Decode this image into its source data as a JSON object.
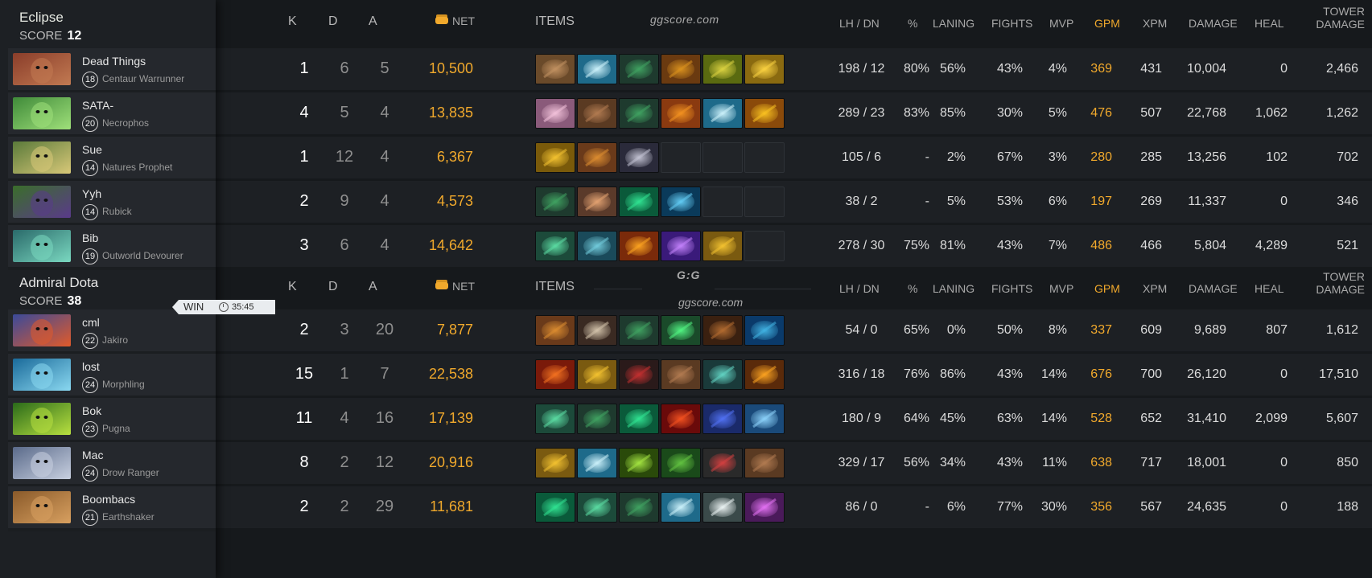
{
  "watermark_text": "ggscore.com",
  "logo": {
    "main": "G:G",
    "sub": "ggscore.com"
  },
  "headers": {
    "k": "K",
    "d": "D",
    "a": "A",
    "net": "NET",
    "items": "ITEMS",
    "lhdn": "LH  /  DN",
    "pct": "%",
    "laning": "LANING",
    "fights": "FIGHTS",
    "mvp": "MVP",
    "gpm": "GPM",
    "xpm": "XPM",
    "damage": "DAMAGE",
    "heal": "HEAL",
    "tower1": "TOWER",
    "tower2": "DAMAGE"
  },
  "result": {
    "label": "WIN",
    "duration": "35:45"
  },
  "teams": [
    {
      "name": "Eclipse",
      "score_label": "SCORE",
      "score": "12",
      "players": [
        {
          "name": "Dead Things",
          "level": "18",
          "hero": "Centaur Warrunner",
          "portrait_colors": [
            "#8a3d2a",
            "#c27a52"
          ],
          "k": "1",
          "d": "6",
          "a": "5",
          "net": "10,500",
          "lhdn": "198  /  12",
          "pct": "80%",
          "laning": "56%",
          "fights": "43%",
          "mvp": "4%",
          "gpm": "369",
          "xpm": "431",
          "damage": "10,004",
          "heal": "0",
          "tower": "2,466",
          "items": [
            "boots",
            "blade",
            "staff",
            "orb",
            "helm",
            "gem"
          ]
        },
        {
          "name": "SATA-",
          "level": "20",
          "hero": "Necrophos",
          "portrait_colors": [
            "#3f8a39",
            "#9fe07a"
          ],
          "k": "4",
          "d": "5",
          "a": "4",
          "net": "13,835",
          "lhdn": "289  /  23",
          "pct": "83%",
          "laning": "85%",
          "fights": "30%",
          "mvp": "5%",
          "gpm": "476",
          "xpm": "507",
          "damage": "22,768",
          "heal": "1,062",
          "tower": "1,262",
          "items": [
            "flower",
            "boots2",
            "staff",
            "fire",
            "blade",
            "dagger"
          ]
        },
        {
          "name": "Sue",
          "level": "14",
          "hero": "Natures Prophet",
          "portrait_colors": [
            "#5a7a3a",
            "#d8c878"
          ],
          "k": "1",
          "d": "12",
          "a": "4",
          "net": "6,367",
          "lhdn": "105  /  6",
          "pct": "-",
          "laning": "2%",
          "fights": "67%",
          "mvp": "3%",
          "gpm": "280",
          "xpm": "285",
          "damage": "13,256",
          "heal": "102",
          "tower": "702",
          "items": [
            "gold",
            "lantern",
            "dark",
            "empty",
            "empty",
            "empty"
          ]
        },
        {
          "name": "Yyh",
          "level": "14",
          "hero": "Rubick",
          "portrait_colors": [
            "#3a6e2a",
            "#5a3a8a"
          ],
          "k": "2",
          "d": "9",
          "a": "4",
          "net": "4,573",
          "lhdn": "38  /  2",
          "pct": "-",
          "laning": "5%",
          "fights": "53%",
          "mvp": "6%",
          "gpm": "197",
          "xpm": "269",
          "damage": "11,337",
          "heal": "0",
          "tower": "346",
          "items": [
            "staff",
            "jester",
            "slipper",
            "wave",
            "empty",
            "empty"
          ]
        },
        {
          "name": "Bib",
          "level": "19",
          "hero": "Outworld Devourer",
          "portrait_colors": [
            "#2a6a6a",
            "#7ad8c0"
          ],
          "k": "3",
          "d": "6",
          "a": "4",
          "net": "14,642",
          "lhdn": "278  /  30",
          "pct": "75%",
          "laning": "81%",
          "fights": "43%",
          "mvp": "7%",
          "gpm": "486",
          "xpm": "466",
          "damage": "5,804",
          "heal": "4,289",
          "tower": "521",
          "items": [
            "staff2",
            "tread",
            "fire2",
            "purple",
            "helm2",
            "empty"
          ]
        }
      ]
    },
    {
      "name": "Admiral Dota",
      "score_label": "SCORE",
      "score": "38",
      "players": [
        {
          "name": "cml",
          "level": "22",
          "hero": "Jakiro",
          "portrait_colors": [
            "#3a4a9a",
            "#e05a2a"
          ],
          "k": "2",
          "d": "3",
          "a": "20",
          "net": "7,877",
          "lhdn": "54  /  0",
          "pct": "65%",
          "laning": "0%",
          "fights": "50%",
          "mvp": "8%",
          "gpm": "337",
          "xpm": "609",
          "damage": "9,689",
          "heal": "807",
          "tower": "1,612",
          "items": [
            "lantern",
            "axe",
            "staff",
            "emerald",
            "cloak",
            "globe"
          ]
        },
        {
          "name": "lost",
          "level": "24",
          "hero": "Morphling",
          "portrait_colors": [
            "#1a6a9a",
            "#8ad8f0"
          ],
          "k": "15",
          "d": "1",
          "a": "7",
          "net": "22,538",
          "lhdn": "316  /  18",
          "pct": "76%",
          "laning": "86%",
          "fights": "43%",
          "mvp": "14%",
          "gpm": "676",
          "xpm": "700",
          "damage": "26,120",
          "heal": "0",
          "tower": "17,510",
          "items": [
            "cross",
            "helm2",
            "mask",
            "boots2",
            "eye",
            "sun"
          ]
        },
        {
          "name": "Bok",
          "level": "23",
          "hero": "Pugna",
          "portrait_colors": [
            "#2a6a1a",
            "#b8e040"
          ],
          "k": "11",
          "d": "4",
          "a": "16",
          "net": "17,139",
          "lhdn": "180  /  9",
          "pct": "64%",
          "laning": "45%",
          "fights": "63%",
          "mvp": "14%",
          "gpm": "528",
          "xpm": "652",
          "damage": "31,410",
          "heal": "2,099",
          "tower": "5,607",
          "items": [
            "staff2",
            "staff",
            "slipper",
            "spear",
            "mantle",
            "orb2"
          ]
        },
        {
          "name": "Mac",
          "level": "24",
          "hero": "Drow Ranger",
          "portrait_colors": [
            "#5a6a8a",
            "#c8d0e0"
          ],
          "k": "8",
          "d": "2",
          "a": "12",
          "net": "20,916",
          "lhdn": "329  /  17",
          "pct": "56%",
          "laning": "34%",
          "fights": "43%",
          "mvp": "11%",
          "gpm": "638",
          "xpm": "717",
          "damage": "18,001",
          "heal": "0",
          "tower": "850",
          "items": [
            "helm2",
            "blade",
            "greenblade",
            "leaf",
            "claw",
            "boots2"
          ]
        },
        {
          "name": "Boombacs",
          "level": "21",
          "hero": "Earthshaker",
          "portrait_colors": [
            "#8a5a2a",
            "#d8a060"
          ],
          "k": "2",
          "d": "2",
          "a": "29",
          "net": "11,681",
          "lhdn": "86  /  0",
          "pct": "-",
          "laning": "6%",
          "fights": "77%",
          "mvp": "30%",
          "gpm": "356",
          "xpm": "567",
          "damage": "24,635",
          "heal": "0",
          "tower": "188",
          "items": [
            "slipper",
            "staff2",
            "staff",
            "blade",
            "wind",
            "pink"
          ]
        }
      ]
    }
  ],
  "item_colors": {
    "boots": [
      "#6a4a2a",
      "#c09060"
    ],
    "boots2": [
      "#5a3a22",
      "#b07a50"
    ],
    "blade": [
      "#1e6a8a",
      "#c8eef8"
    ],
    "staff": [
      "#1e3a2e",
      "#3fa060"
    ],
    "staff2": [
      "#1c4a3a",
      "#5ad8a0"
    ],
    "orb": [
      "#6a3a10",
      "#d8901e"
    ],
    "orb2": [
      "#1a4a7a",
      "#8ad0f8"
    ],
    "helm": [
      "#5a6a10",
      "#d8d040"
    ],
    "helm2": [
      "#7a5a10",
      "#f0c030"
    ],
    "gem": [
      "#8a6a10",
      "#f8d040"
    ],
    "flower": [
      "#8a5a7a",
      "#f0c0d8"
    ],
    "fire": [
      "#8a3a10",
      "#f09020"
    ],
    "fire2": [
      "#7a2a0a",
      "#f8a020"
    ],
    "dagger": [
      "#8a4a0a",
      "#f8c020"
    ],
    "gold": [
      "#7a5a0a",
      "#f0c030"
    ],
    "lantern": [
      "#6a3a1a",
      "#d88a30"
    ],
    "dark": [
      "#2a2a3a",
      "#c0c0d0"
    ],
    "jester": [
      "#5a3a2a",
      "#e0a070"
    ],
    "slipper": [
      "#0a5a3a",
      "#30e090"
    ],
    "wave": [
      "#0a3a5a",
      "#60c8f0"
    ],
    "tread": [
      "#1a4a5a",
      "#70c8d8"
    ],
    "purple": [
      "#3a1a7a",
      "#c080f8"
    ],
    "axe": [
      "#3a2a22",
      "#d0c0a8"
    ],
    "emerald": [
      "#1a4a2a",
      "#50f080"
    ],
    "cloak": [
      "#3a2010",
      "#b06a30"
    ],
    "globe": [
      "#0a3a6a",
      "#40b0e0"
    ],
    "cross": [
      "#7a1a0a",
      "#f07020"
    ],
    "mask": [
      "#2a1a1a",
      "#c03030"
    ],
    "eye": [
      "#1a3a3a",
      "#60d0c0"
    ],
    "sun": [
      "#5a2a0a",
      "#f8a020"
    ],
    "spear": [
      "#6a0a0a",
      "#f05020"
    ],
    "mantle": [
      "#1a2a6a",
      "#5070f0"
    ],
    "greenblade": [
      "#2a4a0a",
      "#a0e040"
    ],
    "leaf": [
      "#1a4a1a",
      "#60c040"
    ],
    "claw": [
      "#2a2a2a",
      "#d04040"
    ],
    "wind": [
      "#3a4a4a",
      "#e8f0f0"
    ],
    "pink": [
      "#4a1a5a",
      "#e070f0"
    ]
  }
}
